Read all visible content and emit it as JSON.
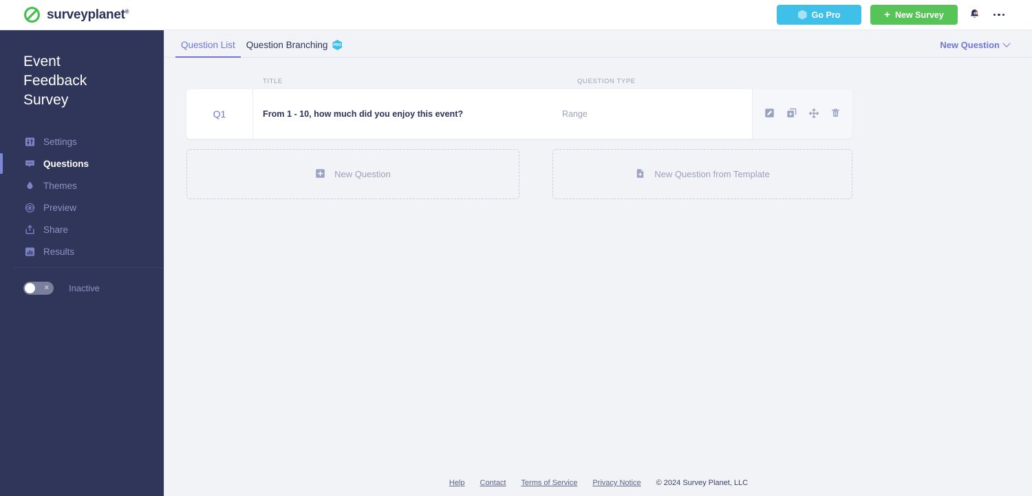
{
  "topbar": {
    "logo_text": "surveyplanet",
    "logo_tm": "®",
    "logo_icon": "surveyplanet-logo-icon",
    "go_pro_label": "Go Pro",
    "go_pro_color": "#3fc0e8",
    "new_survey_label": "New Survey",
    "new_survey_color": "#56c456",
    "bell_icon": "bell-icon",
    "more_icon": "ellipsis-icon"
  },
  "sidebar": {
    "survey_title": "Event Feedback Survey",
    "background": "#2f3659",
    "active_accent": "#7e86d6",
    "items": [
      {
        "label": "Settings",
        "icon": "sliders-icon",
        "active": false
      },
      {
        "label": "Questions",
        "icon": "chat-bubble-icon",
        "active": true
      },
      {
        "label": "Themes",
        "icon": "droplet-icon",
        "active": false
      },
      {
        "label": "Preview",
        "icon": "eye-icon",
        "active": false
      },
      {
        "label": "Share",
        "icon": "share-box-icon",
        "active": false
      },
      {
        "label": "Results",
        "icon": "bar-chart-icon",
        "active": false
      }
    ],
    "status": {
      "label": "Inactive",
      "enabled": false,
      "toggle_mark": "×"
    }
  },
  "main": {
    "tabs": [
      {
        "label": "Question List",
        "active": true,
        "pro": false,
        "badge": ""
      },
      {
        "label": "Question Branching",
        "active": false,
        "pro": true,
        "badge": "PRO"
      }
    ],
    "tab_accent": "#6f76d4",
    "new_question_menu": {
      "label": "New Question",
      "icon": "chevron-down-icon"
    },
    "table": {
      "columns": [
        "TITLE",
        "QUESTION TYPE"
      ],
      "rows": [
        {
          "number": "Q1",
          "title": "From 1 - 10, how much did you enjoy this event?",
          "type": "Range",
          "actions": [
            {
              "name": "edit-question",
              "icon": "pencil-square-icon"
            },
            {
              "name": "duplicate-question",
              "icon": "copy-icon"
            },
            {
              "name": "move-question",
              "icon": "move-arrows-icon"
            },
            {
              "name": "delete-question",
              "icon": "trash-icon"
            }
          ]
        }
      ]
    },
    "add_boxes": [
      {
        "label": "New Question",
        "icon": "plus-square-icon"
      },
      {
        "label": "New Question from Template",
        "icon": "file-plus-icon"
      }
    ]
  },
  "footer": {
    "links": [
      "Help",
      "Contact",
      "Terms of Service",
      "Privacy Notice"
    ],
    "copyright": "© 2024 Survey Planet, LLC"
  }
}
